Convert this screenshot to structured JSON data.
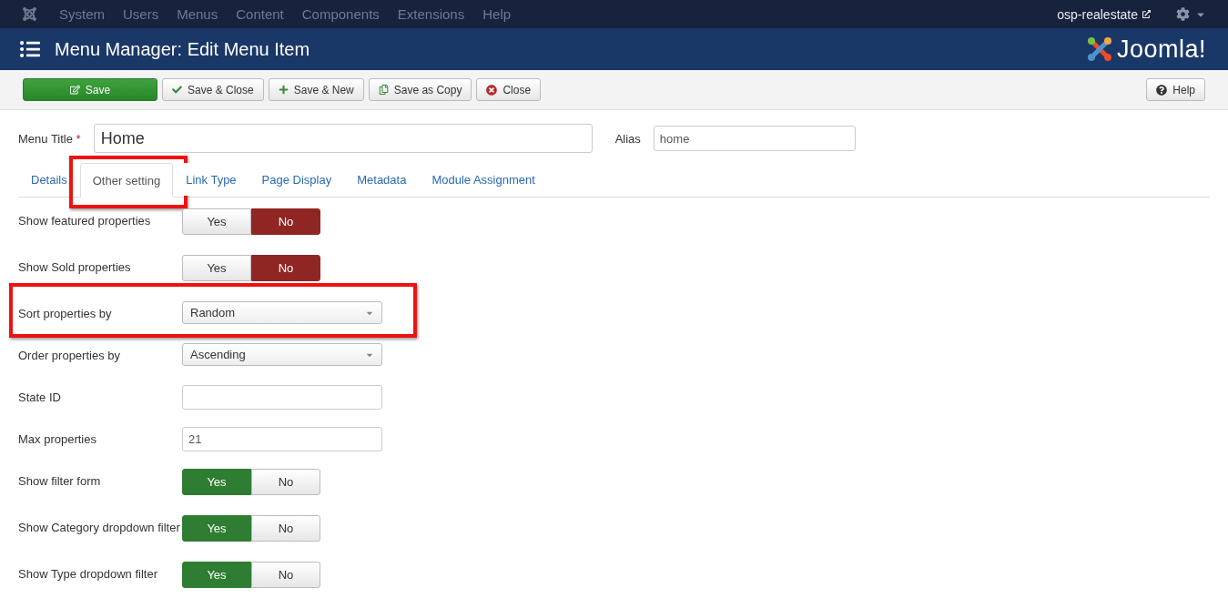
{
  "top_menu": {
    "items": [
      "System",
      "Users",
      "Menus",
      "Content",
      "Components",
      "Extensions",
      "Help"
    ],
    "site_link": "osp-realestate"
  },
  "header": {
    "title": "Menu Manager: Edit Menu Item",
    "logo_text": "Joomla!"
  },
  "toolbar": {
    "buttons": [
      {
        "label": "Save",
        "kind": "primary"
      },
      {
        "label": "Save & Close",
        "kind": "check"
      },
      {
        "label": "Save & New",
        "kind": "plus"
      },
      {
        "label": "Save as Copy",
        "kind": "copy"
      },
      {
        "label": "Close",
        "kind": "close"
      }
    ],
    "help": "Help"
  },
  "title_field": {
    "label": "Menu Title",
    "required_mark": "*",
    "value": "Home"
  },
  "alias_field": {
    "label": "Alias",
    "value": "home"
  },
  "tabs": [
    {
      "label": "Details",
      "selected": false,
      "highlighted": false
    },
    {
      "label": "Other setting",
      "selected": true,
      "highlighted": true
    },
    {
      "label": "Link Type",
      "selected": false,
      "highlighted": false
    },
    {
      "label": "Page Display",
      "selected": false,
      "highlighted": false
    },
    {
      "label": "Metadata",
      "selected": false,
      "highlighted": false
    },
    {
      "label": "Module Assignment",
      "selected": false,
      "highlighted": false
    }
  ],
  "fields": [
    {
      "label": "Show featured properties",
      "kind": "toggle",
      "highlighted": false,
      "options": [
        {
          "label": "Yes",
          "kind": "yes",
          "selected": false
        },
        {
          "label": "No",
          "kind": "no",
          "selected": true
        }
      ]
    },
    {
      "label": "Show Sold properties",
      "kind": "toggle",
      "highlighted": false,
      "options": [
        {
          "label": "Yes",
          "kind": "yes",
          "selected": false
        },
        {
          "label": "No",
          "kind": "no",
          "selected": true
        }
      ]
    },
    {
      "label": "Sort properties by",
      "kind": "select",
      "highlighted": true,
      "value": "Random"
    },
    {
      "label": "Order properties by",
      "kind": "select",
      "highlighted": false,
      "value": "Ascending"
    },
    {
      "label": "State ID",
      "kind": "text",
      "highlighted": false
    },
    {
      "label": "Max properties",
      "kind": "text",
      "highlighted": false,
      "value": "21"
    },
    {
      "label": "Show filter form",
      "kind": "toggle",
      "highlighted": false,
      "options": [
        {
          "label": "Yes",
          "kind": "yes",
          "selected": true
        },
        {
          "label": "No",
          "kind": "no",
          "selected": false
        }
      ]
    },
    {
      "label": "Show Category dropdown filter",
      "kind": "toggle",
      "highlighted": false,
      "options": [
        {
          "label": "Yes",
          "kind": "yes",
          "selected": true
        },
        {
          "label": "No",
          "kind": "no",
          "selected": false
        }
      ]
    },
    {
      "label": "Show Type dropdown filter",
      "kind": "toggle",
      "highlighted": false,
      "options": [
        {
          "label": "Yes",
          "kind": "yes",
          "selected": true
        },
        {
          "label": "No",
          "kind": "no",
          "selected": false
        }
      ]
    }
  ]
}
